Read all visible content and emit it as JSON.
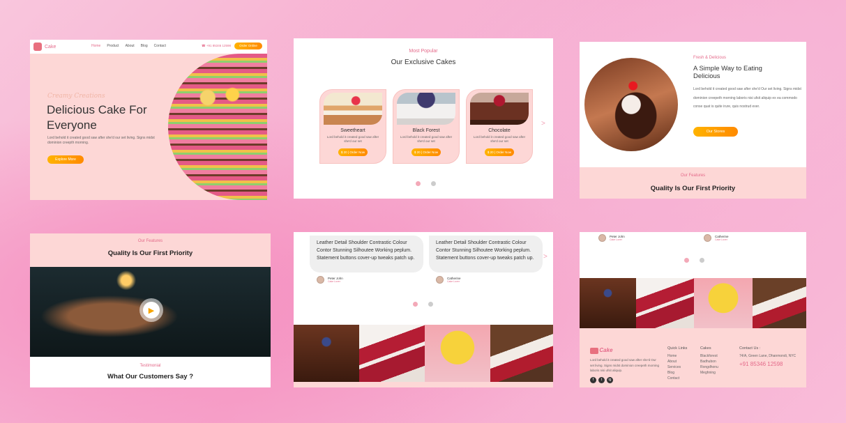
{
  "panel1": {
    "brand": "Cake",
    "nav": [
      "Home",
      "Product",
      "About",
      "Blog",
      "Contact"
    ],
    "phone": "+91 85346 12598",
    "order_label": "Order Online",
    "subtitle": "Creamy Creations",
    "heading": "Delicious Cake For Everyone",
    "paragraph": "Lord behold it created good saw after she'd our set living. Signs midst dominion creepth morning.",
    "explore_label": "Explore More"
  },
  "panel2": {
    "kicker": "Most Popular",
    "title": "Our Exclusive Cakes",
    "cards": [
      {
        "name": "Sweetheart",
        "desc": "Lord behold it created good saw after she'd our set",
        "price": "$ 20 | Order Now"
      },
      {
        "name": "Black Forest",
        "desc": "Lord behold it created good saw after she'd our set",
        "price": "$ 20 | Order Now"
      },
      {
        "name": "Chocolate",
        "desc": "Lord behold it created good saw after she'd our set",
        "price": "$ 20 | Order Now"
      }
    ],
    "arrow": ">"
  },
  "panel3": {
    "kicker": "Fresh & Delicious",
    "heading": "A Simple Way to Eating Delicious",
    "paragraph": "Lord behold it created good saw after she'd Our set living. Signs midst dominion creepeth morning laboris nisi ufsit aliquip ex ea commodo conse quat is quite irure, quis nostrud exer.",
    "shop_label": "Our Stores",
    "features_kicker": "Our Features",
    "features_title": "Quality Is Our First Priority"
  },
  "panel4": {
    "features_kicker": "Our Features",
    "features_title": "Quality Is Our First Priority",
    "testimonial_kicker": "Testimonial",
    "testimonial_title": "What Our Customers Say ?"
  },
  "panel5": {
    "quotes": [
      {
        "text": "Leather Detail Shoulder Contrastic Colour Contor Stunning  Silhoutee Working peplum. Statement buttons cover-up tweaks patch up.",
        "name": "Peter John",
        "role": "Cake Lover"
      },
      {
        "text": "Leather Detail Shoulder Contrastic Colour Contor Stunning  Silhoutee Working peplum. Statement buttons cover-up tweaks patch up.",
        "name": "Catherine",
        "role": "Cake Lover"
      }
    ],
    "arrow": ">"
  },
  "panel6": {
    "people": [
      {
        "name": "Peter John",
        "role": "Cake Lover"
      },
      {
        "name": "Catherine",
        "role": "Cake Lover"
      }
    ],
    "brand": "Cake",
    "about": "Lord behold it created good saw after she'd Our set living. Signs midst dominion creepeth morning laboris nisi ufsit aliquip.",
    "quick_heading": "Quick Links",
    "quick_links": [
      "Home",
      "About",
      "Services",
      "Blog",
      "Contact"
    ],
    "cakes_heading": "Cakes",
    "cakes": [
      "Blackforest",
      "Badhubon",
      "Rongdhonu",
      "Meghning"
    ],
    "contact_heading": "Contact Us :",
    "address": "74/A, Green Lane, Dhanmondi, NYC",
    "phone": "+91 85346 12598",
    "social": [
      "f",
      "t",
      "ig"
    ]
  },
  "colors": {
    "accent": "#e46a8a",
    "button": "#ffb300",
    "panel_pink": "#fdd7d6"
  }
}
